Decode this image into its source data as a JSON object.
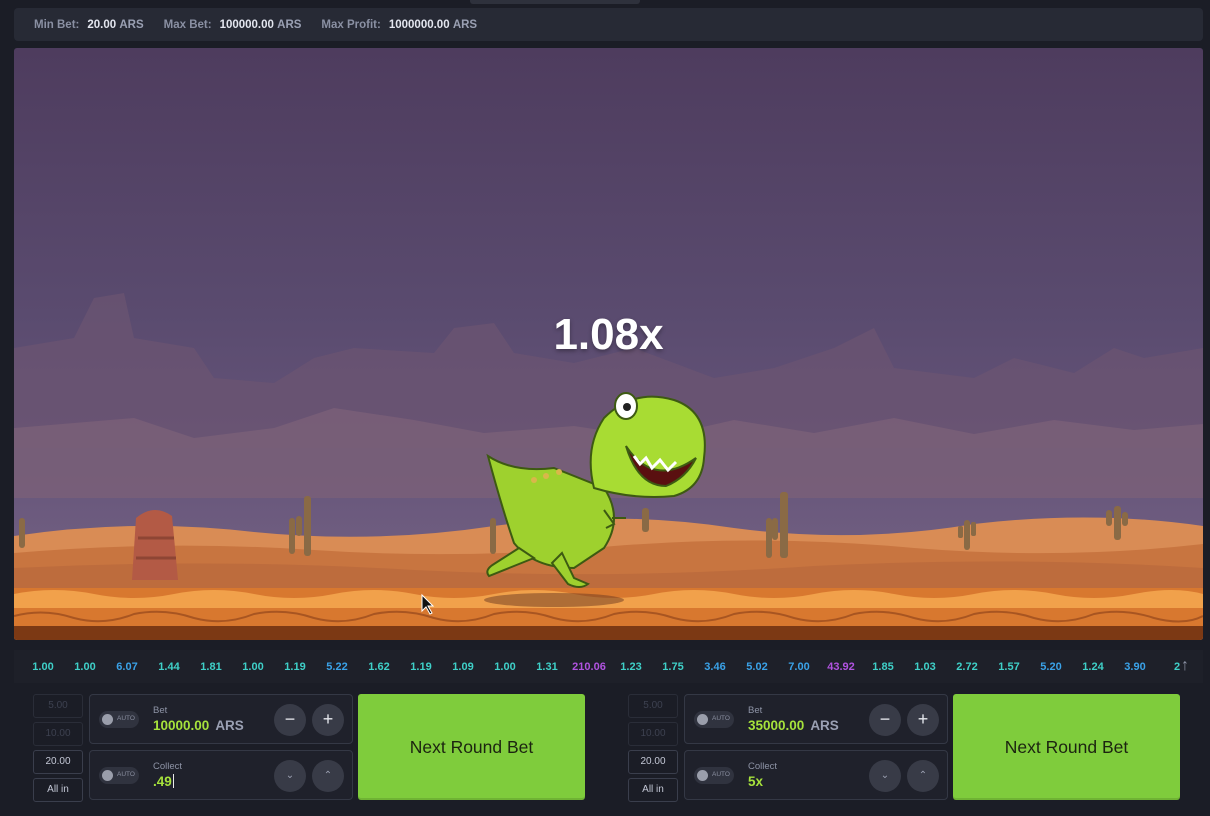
{
  "limits": {
    "min_bet_label": "Min Bet:",
    "min_bet_value": "20.00",
    "min_bet_currency": "ARS",
    "max_bet_label": "Max Bet:",
    "max_bet_value": "100000.00",
    "max_bet_currency": "ARS",
    "max_profit_label": "Max Profit:",
    "max_profit_value": "1000000.00",
    "max_profit_currency": "ARS"
  },
  "game": {
    "multiplier": "1.08x"
  },
  "history": [
    {
      "v": "1.00",
      "c": "#3fd0c8"
    },
    {
      "v": "1.00",
      "c": "#3fd0c8"
    },
    {
      "v": "6.07",
      "c": "#3aa2e8"
    },
    {
      "v": "1.44",
      "c": "#3fd0c8"
    },
    {
      "v": "1.81",
      "c": "#3fd0c8"
    },
    {
      "v": "1.00",
      "c": "#3fd0c8"
    },
    {
      "v": "1.19",
      "c": "#3fd0c8"
    },
    {
      "v": "5.22",
      "c": "#3aa2e8"
    },
    {
      "v": "1.62",
      "c": "#3fd0c8"
    },
    {
      "v": "1.19",
      "c": "#3fd0c8"
    },
    {
      "v": "1.09",
      "c": "#3fd0c8"
    },
    {
      "v": "1.00",
      "c": "#3fd0c8"
    },
    {
      "v": "1.31",
      "c": "#3fd0c8"
    },
    {
      "v": "210.06",
      "c": "#b153e0"
    },
    {
      "v": "1.23",
      "c": "#3fd0c8"
    },
    {
      "v": "1.75",
      "c": "#3fd0c8"
    },
    {
      "v": "3.46",
      "c": "#3aa2e8"
    },
    {
      "v": "5.02",
      "c": "#3aa2e8"
    },
    {
      "v": "7.00",
      "c": "#3aa2e8"
    },
    {
      "v": "43.92",
      "c": "#b153e0"
    },
    {
      "v": "1.85",
      "c": "#3fd0c8"
    },
    {
      "v": "1.03",
      "c": "#3fd0c8"
    },
    {
      "v": "2.72",
      "c": "#3fd0c8"
    },
    {
      "v": "1.57",
      "c": "#3fd0c8"
    },
    {
      "v": "5.20",
      "c": "#3aa2e8"
    },
    {
      "v": "1.24",
      "c": "#3fd0c8"
    },
    {
      "v": "3.90",
      "c": "#3aa2e8"
    },
    {
      "v": "2",
      "c": "#3fd0c8"
    }
  ],
  "panel1": {
    "quick_1": "5.00",
    "quick_2": "10.00",
    "quick_3": "20.00",
    "quick_4": "All in",
    "auto_label": "AUTO",
    "bet_label": "Bet",
    "bet_value": "10000.00",
    "bet_currency": "ARS",
    "collect_label": "Collect",
    "collect_value": ".49",
    "minus": "−",
    "plus": "+",
    "down": "⌄",
    "up": "⌃",
    "action_label": "Next Round Bet"
  },
  "panel2": {
    "quick_1": "5.00",
    "quick_2": "10.00",
    "quick_3": "20.00",
    "quick_4": "All in",
    "auto_label": "AUTO",
    "bet_label": "Bet",
    "bet_value": "35000.00",
    "bet_currency": "ARS",
    "collect_label": "Collect",
    "collect_value": "5x",
    "minus": "−",
    "plus": "+",
    "down": "⌄",
    "up": "⌃",
    "action_label": "Next Round Bet"
  },
  "colors": {
    "accent": "#7fcc3c",
    "bet_value": "#a6e23c",
    "history_low": "#3fd0c8",
    "history_mid": "#3aa2e8",
    "history_high": "#b153e0"
  }
}
